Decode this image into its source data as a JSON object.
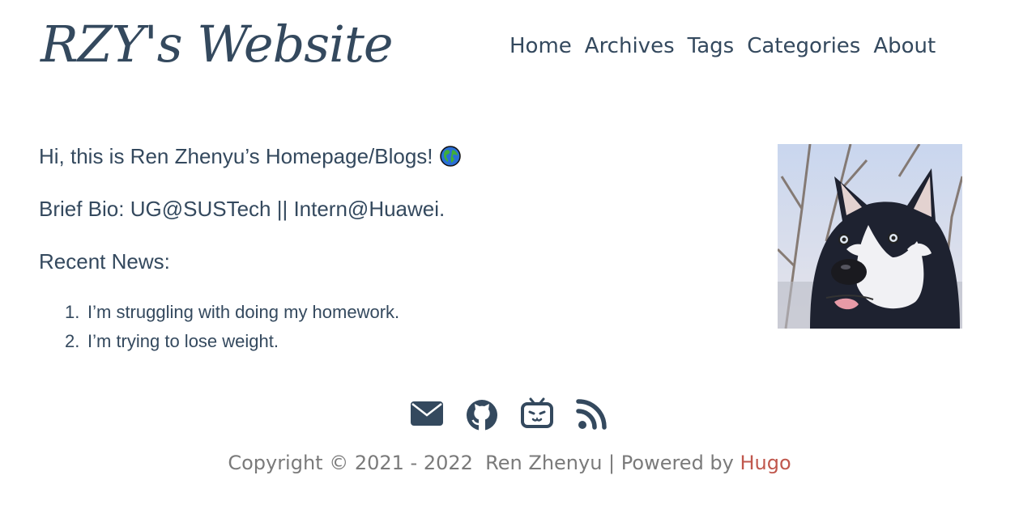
{
  "header": {
    "site_title": "RZY's Website",
    "nav": [
      {
        "label": "Home"
      },
      {
        "label": "Archives"
      },
      {
        "label": "Tags"
      },
      {
        "label": "Categories"
      },
      {
        "label": "About"
      }
    ]
  },
  "main": {
    "intro": "Hi, this is Ren Zhenyu’s Homepage/Blogs!",
    "intro_icon": "globe-icon",
    "bio": "Brief Bio: UG@SUSTech || Intern@Huawei.",
    "news_heading": "Recent News:",
    "news": [
      {
        "num": "1.",
        "text": "I’m struggling with doing my homework."
      },
      {
        "num": "2.",
        "text": "I’m trying to lose weight."
      }
    ],
    "avatar": "husky-dog-photo"
  },
  "social": [
    {
      "icon": "mail-icon"
    },
    {
      "icon": "github-icon"
    },
    {
      "icon": "bilibili-icon"
    },
    {
      "icon": "rss-icon"
    }
  ],
  "footer": {
    "copyright": "Copyright © 2021 - 2022  Ren Zhenyu | Powered by ",
    "powered_link": "Hugo",
    "link_color": "#c0574d"
  },
  "colors": {
    "text": "#34495e",
    "muted": "#7a7a7a"
  }
}
